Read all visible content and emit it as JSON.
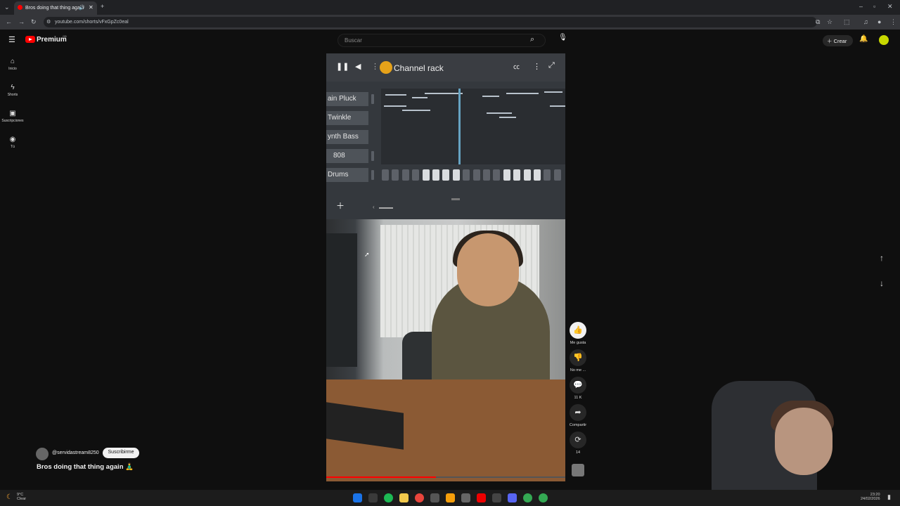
{
  "browser": {
    "tab_title": "Bros doing that thing again",
    "new_tab": "+",
    "url": "youtube.com/shorts/vFxGpZc0eal"
  },
  "header": {
    "logo_text": "Premium",
    "logo_sup": "GB",
    "search_placeholder": "Buscar",
    "create_label": "Crear"
  },
  "sidebar": {
    "items": [
      {
        "label": "Inicio",
        "icon": "home-icon"
      },
      {
        "label": "Shorts",
        "icon": "shorts-icon"
      },
      {
        "label": "Suscripciones",
        "icon": "subscriptions-icon"
      },
      {
        "label": "Tú",
        "icon": "you-icon"
      }
    ]
  },
  "video": {
    "channel_rack_title": "Channel rack",
    "channels": [
      "ain Pluck",
      "Twinkle",
      "ynth Bass",
      "808",
      "Drums"
    ],
    "steps_on": [
      false,
      false,
      false,
      false,
      true,
      true,
      true,
      true,
      false,
      false,
      false,
      false,
      true,
      true,
      true,
      true,
      false,
      false
    ],
    "progress": 0.46
  },
  "actions": {
    "like_label": "Me gusta",
    "dislike_label": "No me ...",
    "comments_count": "11 K",
    "share_label": "Compartir",
    "remix_count": "14"
  },
  "channel": {
    "handle": "@servidastream8250",
    "subscribe_label": "Suscribirme",
    "title": "Bros doing that thing again 🧘‍♂️"
  },
  "taskbar": {
    "weather_temp": "9°C",
    "weather_desc": "Clear",
    "time": "23:20",
    "date": "24/02/2026"
  },
  "colors": {
    "youtube_red": "#ff0000",
    "background": "#0f0f0f",
    "playhead": "#66a3c2"
  }
}
